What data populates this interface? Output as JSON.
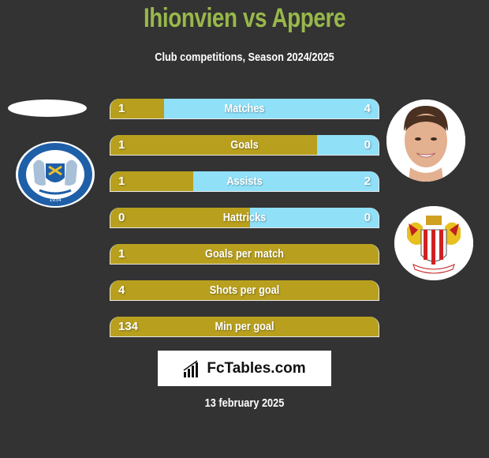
{
  "header": {
    "title": "Ihionvien vs Appere",
    "subtitle": "Club competitions, Season 2024/2025"
  },
  "colors": {
    "background": "#333333",
    "title": "#98b84a",
    "left_bar": "#b8a01e",
    "right_bar": "#90e0f8",
    "text": "#ffffff"
  },
  "left_team": {
    "crest_icon": "peterborough-united-crest-icon",
    "crest_year": "1934"
  },
  "right_player": {
    "photo_icon": "player-photo-icon"
  },
  "right_team": {
    "crest_icon": "stevenage-fc-crest-icon"
  },
  "stats": [
    {
      "label": "Matches",
      "left": "1",
      "right": "4",
      "left_share": 0.2
    },
    {
      "label": "Goals",
      "left": "1",
      "right": "0",
      "left_share": 0.77
    },
    {
      "label": "Assists",
      "left": "1",
      "right": "2",
      "left_share": 0.31
    },
    {
      "label": "Hattricks",
      "left": "0",
      "right": "0",
      "left_share": 0.52
    },
    {
      "label": "Goals per match",
      "left": "1",
      "right": "",
      "left_share": 1.0
    },
    {
      "label": "Shots per goal",
      "left": "4",
      "right": "",
      "left_share": 1.0
    },
    {
      "label": "Min per goal",
      "left": "134",
      "right": "",
      "left_share": 1.0
    }
  ],
  "footer": {
    "logo_text": "FcTables.com",
    "date": "13 february 2025"
  }
}
